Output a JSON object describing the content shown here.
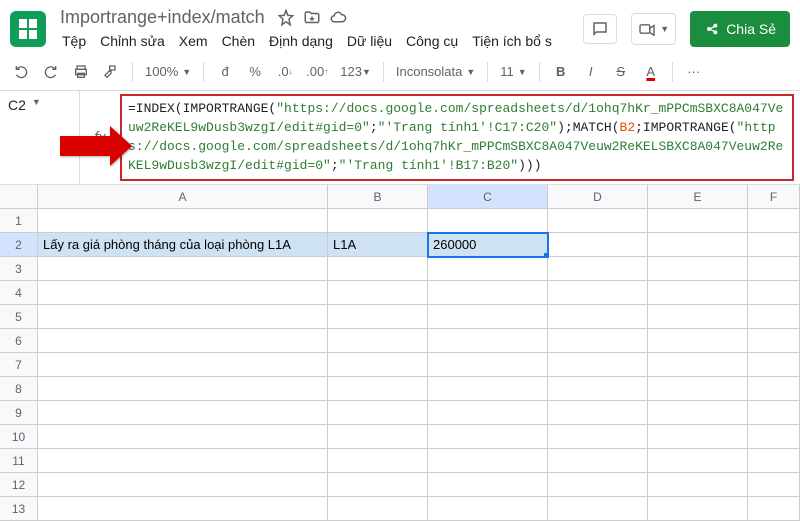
{
  "doc": {
    "name": "Importrange+index/match",
    "share": "Chia Sẻ"
  },
  "menu": {
    "file": "Tệp",
    "edit": "Chỉnh sửa",
    "view": "Xem",
    "insert": "Chèn",
    "format": "Định dạng",
    "data": "Dữ liệu",
    "tools": "Công cụ",
    "ext": "Tiện ích bổ s"
  },
  "tb": {
    "zoom": "100%",
    "cur": "đ",
    "pct": "%",
    "dec0": ".0",
    "dec00": ".00",
    "num": "123",
    "font": "Inconsolata",
    "size": "11",
    "bold": "B",
    "italic": "I",
    "strike": "S",
    "color": "A",
    "more": "···"
  },
  "cellref": "C2",
  "formula": {
    "p1": "=INDEX(IMPORTRANGE(",
    "url1": "\"https://docs.google.com/spreadsheets/d/1ohq7hKr_mPPCmSBXC8A047Veuw2ReKEL9wDusb3wzgI/edit#gid=0\"",
    "sep1": ";",
    "range1": "\"'Trang tính1'!C17:C20\"",
    "p2": ");MATCH(",
    "ref": "B2",
    "p3": ";IMPORTRANGE(",
    "url2": "\"https://docs.google.com/spreadsheets/d/1ohq7hKr_mPPCmSBXC8A047Veuw2ReKELSBXC8A047Veuw2ReKEL9wDusb3wzgI/edit#gid=0\"",
    "sep2": ";",
    "range2": "\"'Trang tính1'!B17:B20\"",
    "p4": ")))"
  },
  "cols": {
    "a": "A",
    "b": "B",
    "c": "C",
    "d": "D",
    "e": "E",
    "f": "F"
  },
  "rows": {
    "r1": "1",
    "r2": "2",
    "r3": "3",
    "r4": "4",
    "r5": "5",
    "r6": "6",
    "r7": "7",
    "r8": "8",
    "r9": "9",
    "r10": "10",
    "r11": "11",
    "r12": "12",
    "r13": "13"
  },
  "cells": {
    "a2": "Lấy ra giá phòng tháng của loại phòng L1A",
    "b2": "L1A",
    "c2": "260000"
  }
}
